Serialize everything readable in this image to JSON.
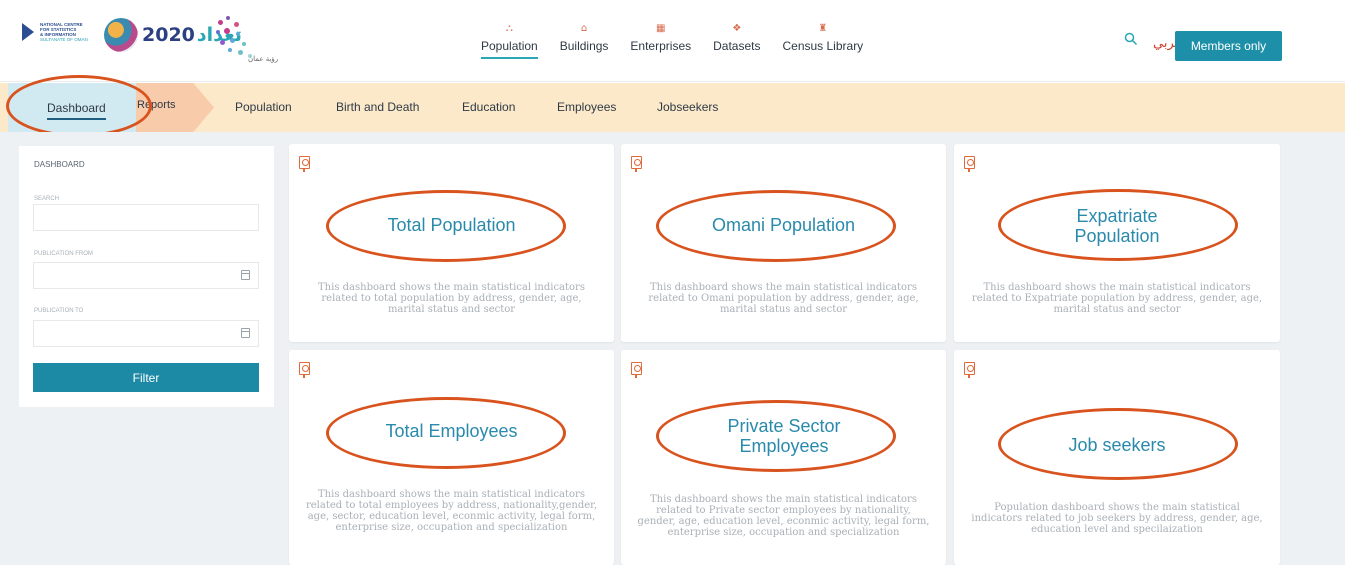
{
  "header": {
    "ncsi_logo_lines": [
      "NATIONAL CENTRE",
      "FOR STATISTICS",
      "& INFORMATION"
    ],
    "ncsi_logo_sub": "SULTANATE OF OMAN",
    "census_year": "2020",
    "census_arabic": "تعداد",
    "partner_logo_text": "رؤية عمان",
    "nav": [
      {
        "label": "Population",
        "icon": "population-icon",
        "glyph": "⛬"
      },
      {
        "label": "Buildings",
        "icon": "buildings-icon",
        "glyph": "⌂"
      },
      {
        "label": "Enterprises",
        "icon": "enterprises-icon",
        "glyph": "▦"
      },
      {
        "label": "Datasets",
        "icon": "datasets-icon",
        "glyph": "❖"
      },
      {
        "label": "Census Library",
        "icon": "census-library-icon",
        "glyph": "♜"
      }
    ],
    "lang_label": "عربي",
    "members_label": "Members only"
  },
  "subnav": {
    "items": [
      "Dashboard",
      "Reports",
      "Population",
      "Birth and Death",
      "Education",
      "Employees",
      "Jobseekers"
    ]
  },
  "sidebar": {
    "title": "DASHBOARD",
    "search_label": "SEARCH",
    "from_label": "PUBLICATION FROM",
    "to_label": "PUBLICATION TO",
    "filter_label": "Filter"
  },
  "cards": [
    {
      "title": "Total Population",
      "desc": "This dashboard shows the main statistical indicators related to total population by address, gender, age, marital status and sector"
    },
    {
      "title": "Omani Population",
      "desc": "This dashboard shows the main statistical indicators related to Omani population by address, gender, age, marital status and sector"
    },
    {
      "title": "Expatriate Population",
      "desc": "This dashboard shows the main statistical indicators related to Expatriate population by address, gender, age, marital status and sector"
    },
    {
      "title": "Total Employees",
      "desc": "This dashboard shows the main statistical indicators related to total employees by address, nationality,gender, age, sector, education level, econmic activity, legal form, enterprise size, occupation and specialization"
    },
    {
      "title": "Private Sector Employees",
      "desc": "This dashboard shows the main statistical indicators related to Private sector employees by nationality, gender, age, education level, econmic activity, legal form, enterprise size, occupation and specialization"
    },
    {
      "title": "Job seekers",
      "desc": "Population dashboard shows the main statistical indicators related to job seekers by address, gender, age, education level and specilaization"
    }
  ],
  "colors": {
    "accent": "#1e8fa8",
    "annotation": "#d9531e",
    "subnav_bg": "#fbe9c9"
  }
}
